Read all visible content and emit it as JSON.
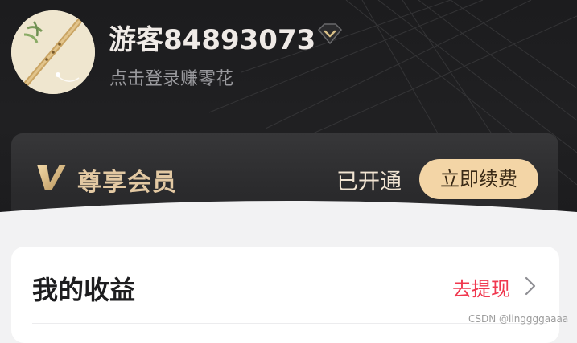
{
  "profile": {
    "username": "游客84893073",
    "subtitle": "点击登录赚零花",
    "badge_icon": "diamond-icon"
  },
  "vip": {
    "logo_icon": "v-logo-icon",
    "title": "尊享会员",
    "status": "已开通",
    "renew_label": "立即续费"
  },
  "earnings": {
    "title": "我的收益",
    "withdraw_label": "去提现",
    "chevron_icon": "chevron-right-icon"
  },
  "watermark": "CSDN @linggggaaaa",
  "colors": {
    "header_bg": "#1c1c1e",
    "gold": "#e3c9a3",
    "renew_button_bg": "#f3d5a6",
    "withdraw_red": "#f0384f"
  }
}
